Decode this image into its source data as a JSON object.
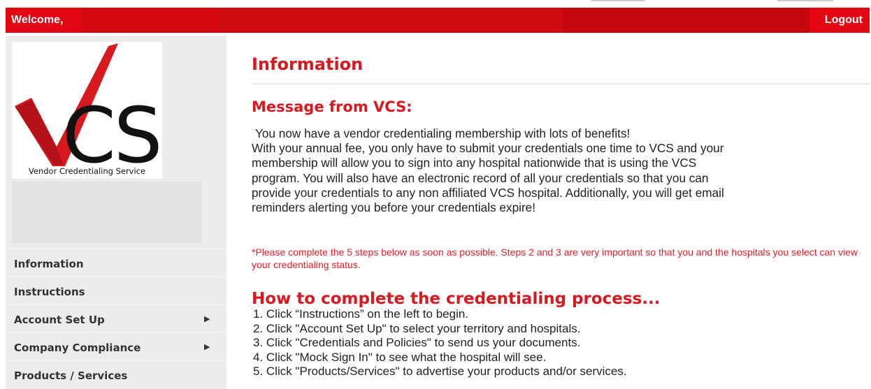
{
  "header": {
    "welcome": "Welcome,",
    "logout": "Logout"
  },
  "logo": {
    "letters": "CS",
    "caption": "Vendor Credentialing Service"
  },
  "sidebar": {
    "items": [
      {
        "label": "Information",
        "has_submenu": false
      },
      {
        "label": "Instructions",
        "has_submenu": false
      },
      {
        "label": "Account Set Up",
        "has_submenu": true
      },
      {
        "label": "Company Compliance",
        "has_submenu": true
      },
      {
        "label": "Products / Services",
        "has_submenu": false
      }
    ],
    "submenu_arrow": "▶"
  },
  "main": {
    "title": "Information",
    "message_title": "Message from VCS:",
    "message_lines": [
      "You now have a vendor credentialing membership with lots of benefits!",
      "With your annual fee, you only have to submit your credentials one time to VCS and your",
      "membership will allow you to sign into any hospital nationwide that is using the VCS",
      "program.  You will also have an electronic record of all your credentials so that you can",
      "provide your credentials to any non affiliated VCS hospital.  Additionally, you will get email",
      "reminders alerting you before your credentials expire!"
    ],
    "note": "*Please complete the 5 steps below as soon as possible.  Steps 2 and 3 are very important so that you and the hospitals you select can view your credentialing status.",
    "how_title": "How to complete the credentialing process...",
    "steps": [
      "1.  Click “Instructions” on the left to begin.",
      "2.  Click \"Account Set Up\" to select your territory and hospitals.",
      "3.  Click \"Credentials and Policies\" to send us your documents.",
      "4.  Click \"Mock Sign In\" to see what the hospital will see.",
      "5.  Click \"Products/Services\" to advertise your products and/or services."
    ]
  },
  "colors": {
    "brand_red": "#e30613",
    "title_red": "#d71920",
    "note_red": "#e0202a",
    "sidebar_bg": "#ececec"
  }
}
